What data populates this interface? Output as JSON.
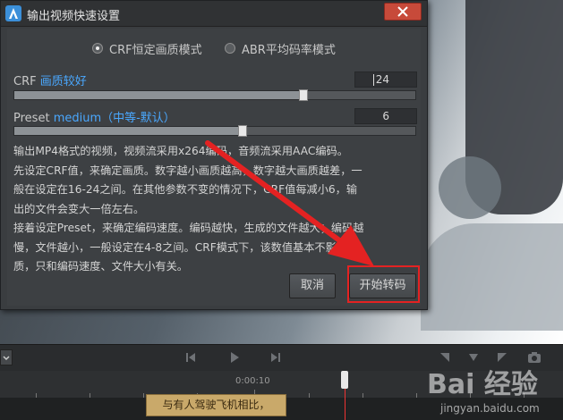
{
  "window": {
    "title": "输出视频快速设置"
  },
  "modes": [
    {
      "label": "CRF恒定画质模式",
      "selected": true
    },
    {
      "label": "ABR平均码率模式",
      "selected": false
    }
  ],
  "crf": {
    "label": "CRF",
    "quality_text": "画质较好",
    "value": "24",
    "slider_fraction": 0.72
  },
  "preset": {
    "label": "Preset",
    "name_text": "medium（中等-默认）",
    "value": "6",
    "slider_fraction": 0.57
  },
  "description": [
    "输出MP4格式的视频，视频流采用x264编码，音频流采用AAC编码。",
    "先设定CRF值，来确定画质。数字越小画质越高，数字越大画质越差，一",
    "般在设定在16-24之间。在其他参数不变的情况下，CRF值每减小6，输",
    "出的文件会变大一倍左右。",
    "接着设定Preset，来确定编码速度。编码越快，生成的文件越大；编码越",
    "慢，文件越小，一般设定在4-8之间。CRF模式下，该数值基本不影响画",
    "质，只和编码速度、文件大小有关。"
  ],
  "buttons": {
    "cancel": "取消",
    "start": "开始转码"
  },
  "timeline": {
    "time_label": "0:00:10",
    "clip_text": "与有人驾驶飞机相比，"
  },
  "watermark": {
    "logo": "Bai 经验",
    "url": "jingyan.baidu.com"
  },
  "colors": {
    "accent_blue": "#4aa8ff",
    "highlight_red": "#e42222",
    "close_red": "#c74a3a"
  }
}
